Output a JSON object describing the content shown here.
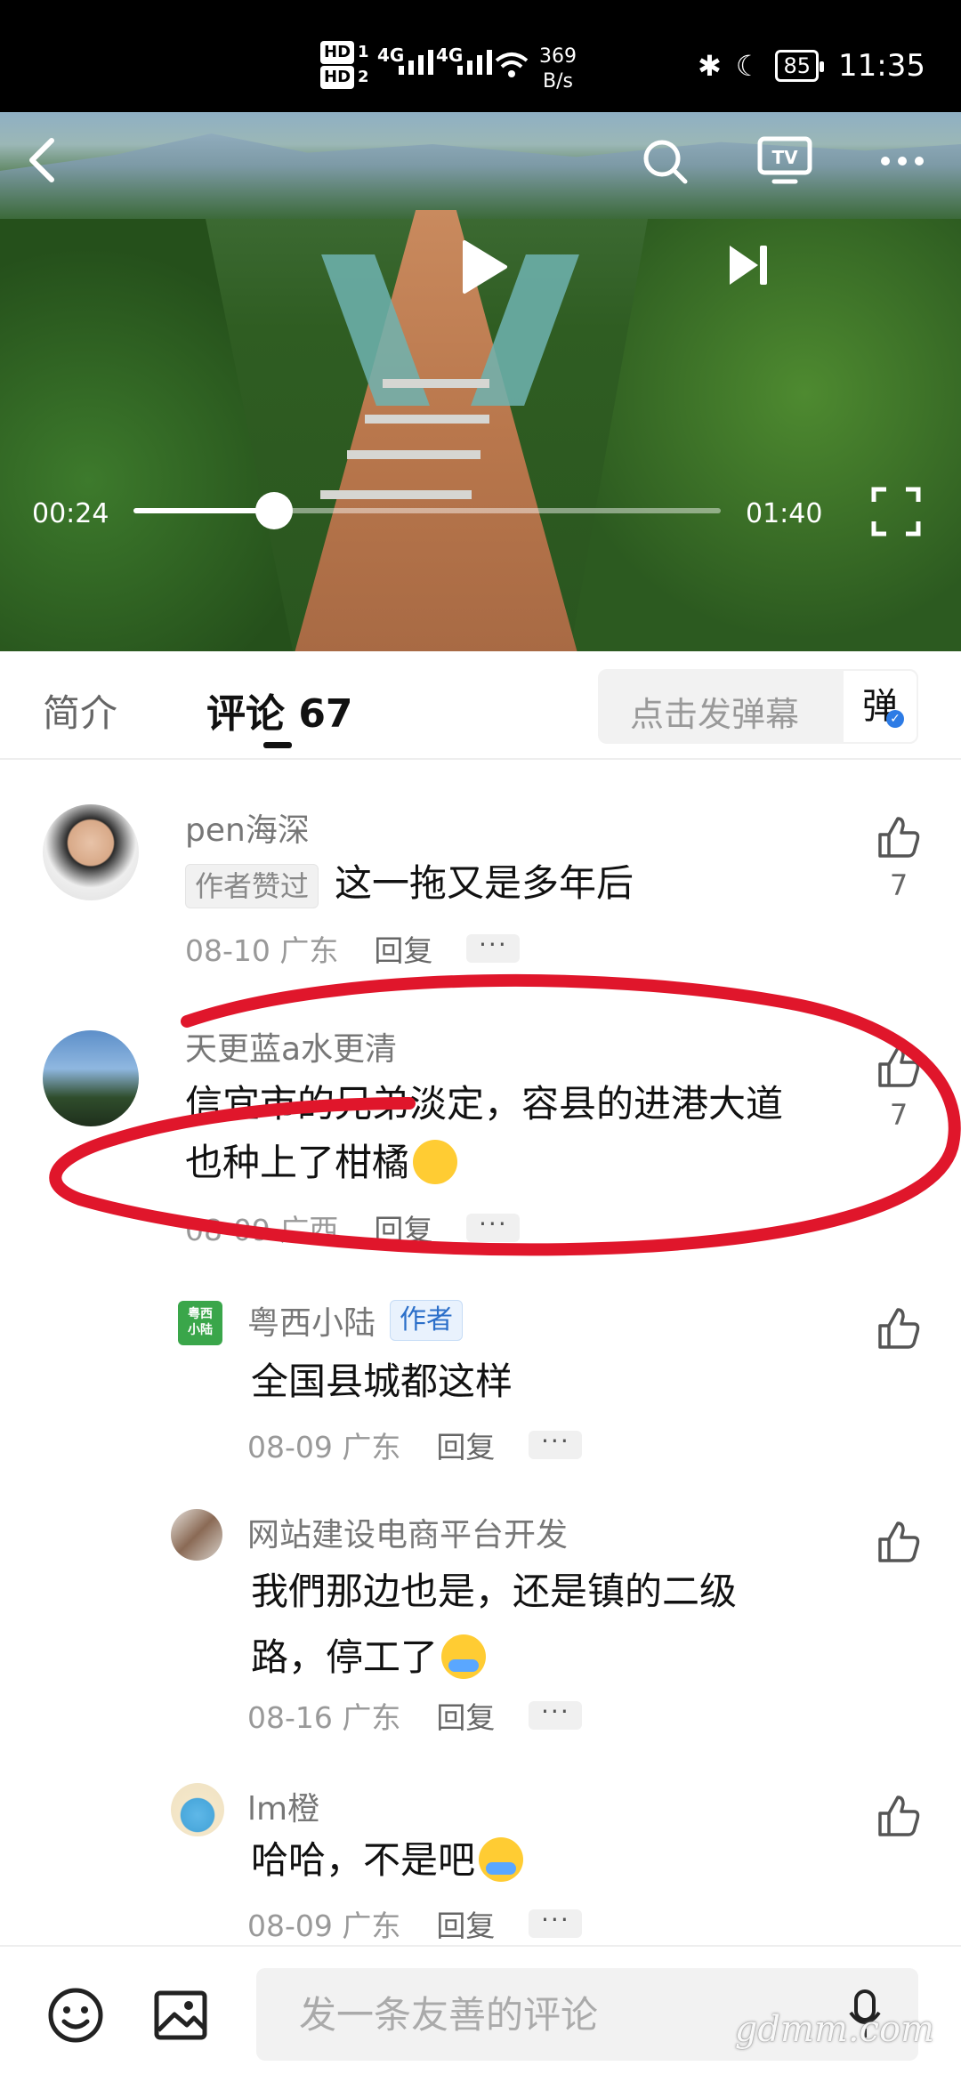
{
  "status_bar": {
    "hd1": "HD",
    "hd1_num": "1",
    "hd2": "HD",
    "hd2_num": "2",
    "signal1": "4G",
    "signal2": "4G",
    "speed_value": "369",
    "speed_unit": "B/s",
    "battery": "85",
    "time": "11:35"
  },
  "video": {
    "current_time": "00:24",
    "total_time": "01:40",
    "progress": 0.24,
    "icons": [
      "back-icon",
      "search-icon",
      "tv-cast-icon",
      "more-icon",
      "play-icon",
      "next-icon",
      "fullscreen-icon"
    ]
  },
  "tabs": {
    "intro": "简介",
    "comments": "评论 67",
    "danmu_placeholder": "点击发弹幕",
    "danmu_button": "弹"
  },
  "comments": [
    {
      "user": "pen海深",
      "badge": "作者赞过",
      "text": "这一拖又是多年后",
      "date_location": "08-10 广东",
      "reply": "回复",
      "more": "···",
      "likes": "7"
    },
    {
      "user": "天更蓝a水更清",
      "text_line1": "信宜市的兄弟淡定，容县的进港大道",
      "text_line2": "也种上了柑橘",
      "date_location": "08-09 广西",
      "reply": "回复",
      "more": "···",
      "likes": "7",
      "replies": [
        {
          "user": "粤西小陆",
          "avatar_text": "粤西\n小陆",
          "badge": "作者",
          "text": "全国县城都这样",
          "date_location": "08-09 广东",
          "reply": "回复",
          "more": "···"
        },
        {
          "user": "网站建设电商平台开发",
          "text_line1": "我們那边也是，还是镇的二级",
          "text_line2": "路，停工了",
          "date_location": "08-16 广东",
          "reply": "回复",
          "more": "···"
        },
        {
          "user": "lm橙",
          "text": "哈哈，不是吧",
          "date_location": "08-09 广东",
          "reply": "回复",
          "more": "···"
        }
      ]
    }
  ],
  "bottom_bar": {
    "input_placeholder": "发一条友善的评论"
  },
  "watermark": "gdmm.com",
  "colors": {
    "annotation_red": "#e0162b",
    "accent_blue": "#2d7be5"
  }
}
